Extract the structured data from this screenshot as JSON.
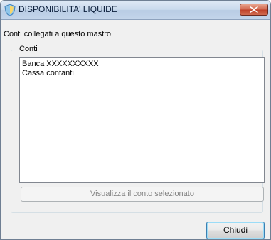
{
  "window": {
    "title": "DISPONIBILITA' LIQUIDE",
    "app_icon": "shield-app-icon",
    "close_icon": "close-icon"
  },
  "main": {
    "linked_label": "Conti collegati a questo mastro",
    "group_label": "Conti",
    "accounts": [
      "Banca XXXXXXXXXX",
      "Cassa contanti"
    ],
    "view_button_label": "Visualizza il conto selezionato",
    "close_button_label": "Chiudi"
  },
  "colors": {
    "close_red": "#c0432a",
    "title_blue": "#c9d9ec",
    "focus_border": "#3c7fb1"
  }
}
